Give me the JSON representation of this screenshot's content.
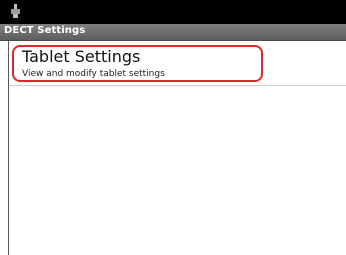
{
  "status_bar": {
    "notification_icon": "usb-debug-icon"
  },
  "title_bar": {
    "title": "DECT Settings"
  },
  "settings_list": {
    "items": [
      {
        "title": "Tablet Settings",
        "summary": "View and modify tablet settings"
      }
    ]
  },
  "colors": {
    "status_bar": "#000000",
    "title_bar": "#6e6e6e",
    "highlight": "#d92b2b"
  }
}
